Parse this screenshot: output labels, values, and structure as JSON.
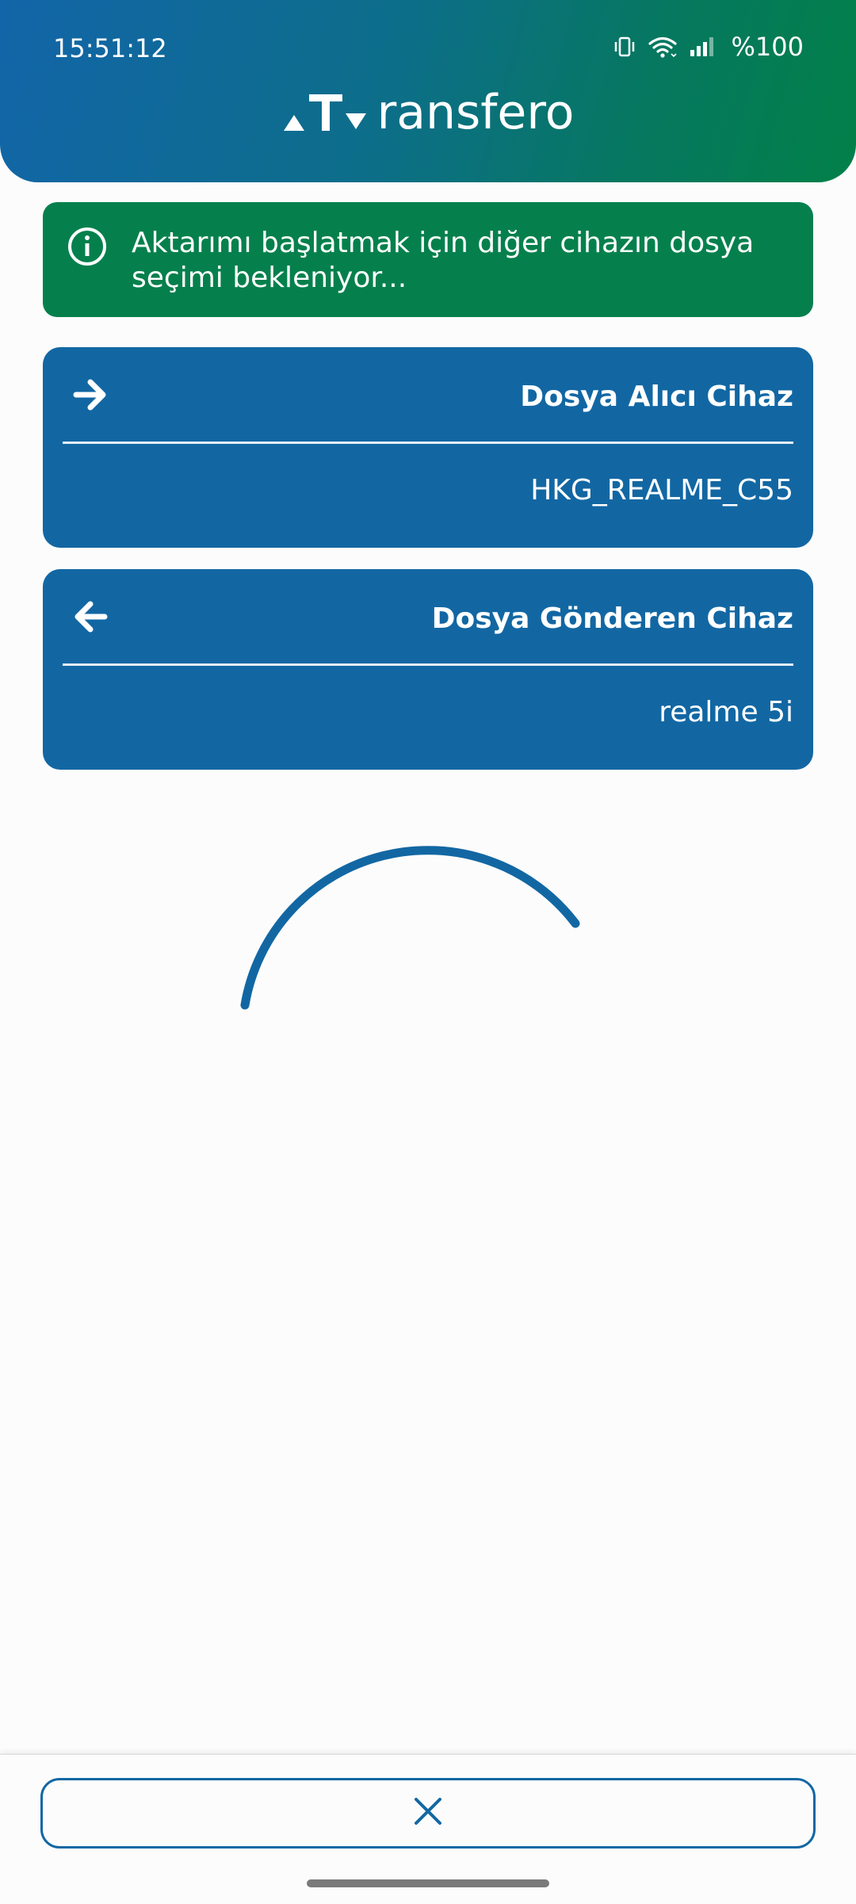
{
  "status_bar": {
    "time": "15:51:12",
    "battery": "%100",
    "icons": [
      "vibrate-icon",
      "wifi-icon",
      "signal-icon"
    ]
  },
  "header": {
    "logo_text": "ransfero",
    "logo_letter": "T"
  },
  "info_banner": {
    "icon": "info-icon",
    "message": "Aktarımı başlatmak için diğer cihazın dosya seçimi bekleniyor..."
  },
  "receiver_card": {
    "icon": "arrow-right-icon",
    "title": "Dosya Alıcı Cihaz",
    "device_name": "HKG_REALME_C55"
  },
  "sender_card": {
    "icon": "arrow-left-icon",
    "title": "Dosya Gönderen Cihaz",
    "device_name": "realme 5i"
  },
  "loading": {
    "icon": "loading-spinner"
  },
  "bottom_bar": {
    "cancel_icon": "close-icon"
  },
  "colors": {
    "primary_blue": "#1267a3",
    "success_green": "#05804c",
    "background": "#fcfcfc"
  }
}
